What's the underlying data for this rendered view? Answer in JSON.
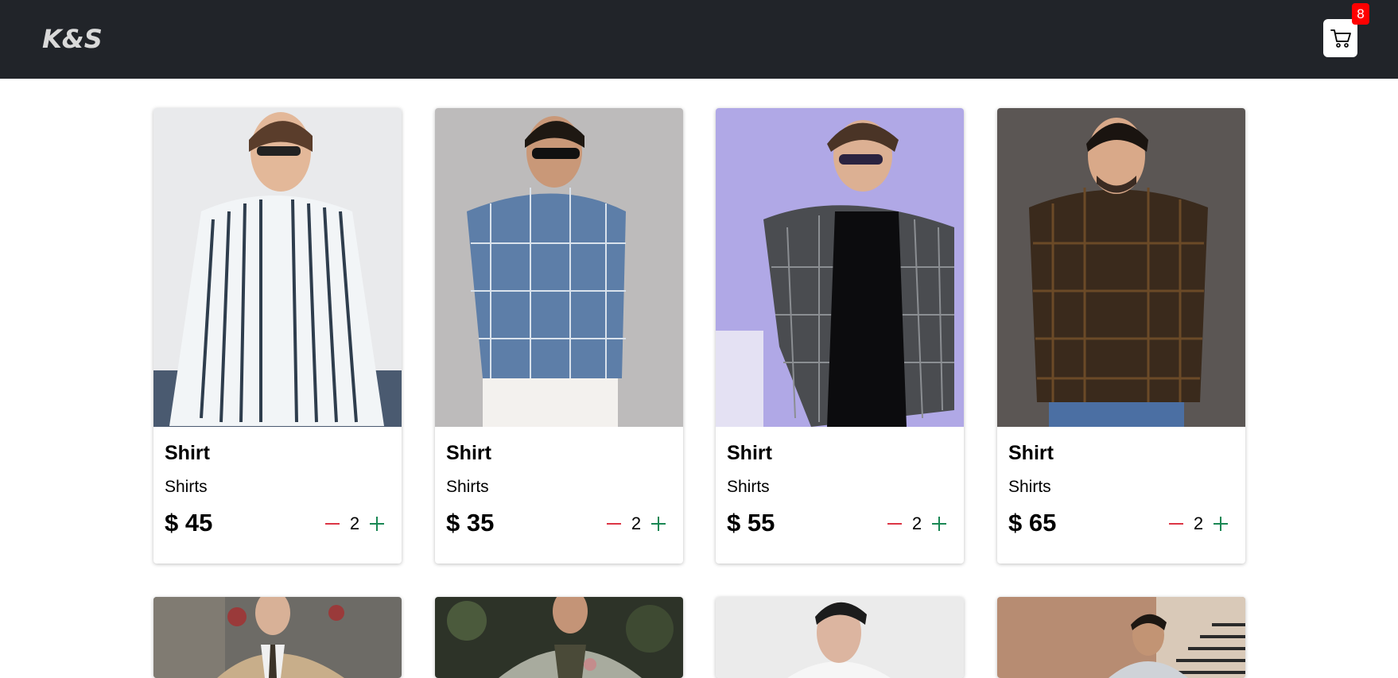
{
  "navbar": {
    "brand": "K&S",
    "cart_count": "8",
    "background": "#212429"
  },
  "products": [
    {
      "title": "Shirt",
      "category": "Shirts",
      "price": "$ 45",
      "quantity": "2",
      "image": "man-striped-shirt"
    },
    {
      "title": "Shirt",
      "category": "Shirts",
      "price": "$ 35",
      "quantity": "2",
      "image": "man-blue-check-shirt"
    },
    {
      "title": "Shirt",
      "category": "Shirts",
      "price": "$ 55",
      "quantity": "2",
      "image": "man-grey-plaid-shirt"
    },
    {
      "title": "Shirt",
      "category": "Shirts",
      "price": "$ 65",
      "quantity": "2",
      "image": "man-brown-check-shirt"
    }
  ],
  "products_row2": [
    {
      "image": "man-beige-suit"
    },
    {
      "image": "man-grey-blazer"
    },
    {
      "image": "man-white-shirt"
    },
    {
      "image": "man-light-blazer-stairs"
    }
  ],
  "colors": {
    "minus": "#dc3545",
    "plus": "#198754",
    "badge": "#ff0000"
  }
}
